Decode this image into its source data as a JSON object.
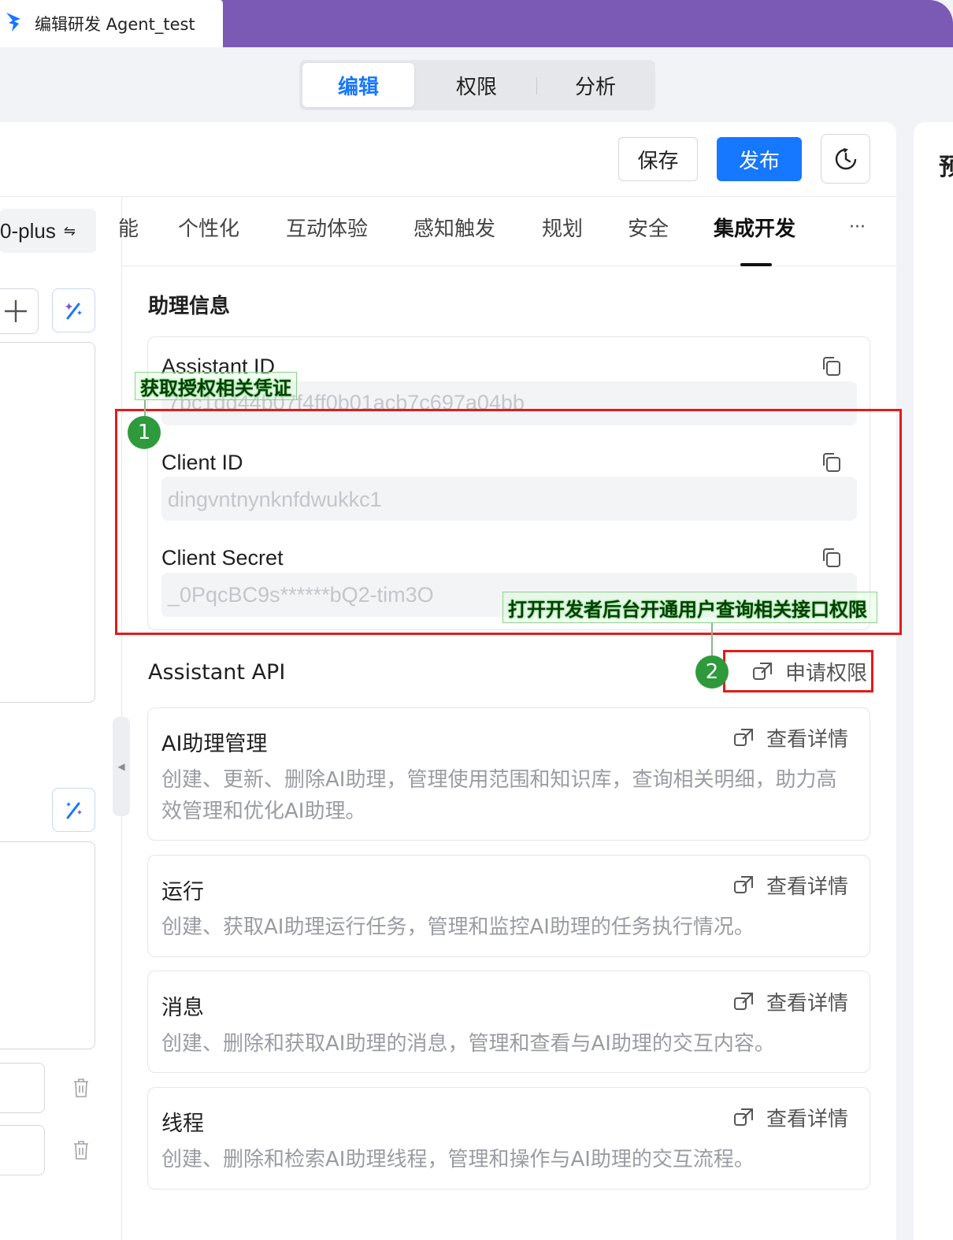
{
  "window": {
    "doc_title": "编辑研发 Agent_test"
  },
  "segmented": {
    "items": [
      "编辑",
      "权限",
      "分析"
    ],
    "active": 0
  },
  "toolbar": {
    "save_label": "保存",
    "publish_label": "发布"
  },
  "model_chip": {
    "label": "0-plus"
  },
  "tabs": {
    "items": [
      "能",
      "个性化",
      "互动体验",
      "感知触发",
      "规划",
      "安全",
      "集成开发"
    ],
    "active": "集成开发",
    "more": "···"
  },
  "right_panel": {
    "partial_glyph": "预"
  },
  "assistant_info": {
    "section_title": "助理信息",
    "fields": [
      {
        "label": "Assistant ID",
        "value": "7bc1dd44b07f4ff0b01acb7c697a04bb"
      },
      {
        "label": "Client ID",
        "value": "dingvntnynknfdwukkc1"
      },
      {
        "label": "Client Secret",
        "value": "_0PqcBC9s******bQ2-tim3O"
      }
    ]
  },
  "assistant_api": {
    "section_title": "Assistant API",
    "apply_label": "申请权限",
    "detail_label": "查看详情",
    "cards": [
      {
        "title": "AI助理管理",
        "desc": "创建、更新、删除AI助理，管理使用范围和知识库，查询相关明细，助力高效管理和优化AI助理。"
      },
      {
        "title": "运行",
        "desc": "创建、获取AI助理运行任务，管理和监控AI助理的任务执行情况。"
      },
      {
        "title": "消息",
        "desc": "创建、删除和获取AI助理的消息，管理和查看与AI助理的交互内容。"
      },
      {
        "title": "线程",
        "desc": "创建、删除和检索AI助理线程，管理和操作与AI助理的交互流程。"
      }
    ]
  },
  "annotations": {
    "step1_number": "1",
    "step1_label": "获取授权相关凭证",
    "step2_number": "2",
    "step2_label": "打开开发者后台开通用户查询相关接口权限"
  },
  "colors": {
    "accent": "#1677ff",
    "titlebar": "#7b5ab6",
    "highlight": "#e31b1b",
    "badge": "#2e9a3c"
  }
}
